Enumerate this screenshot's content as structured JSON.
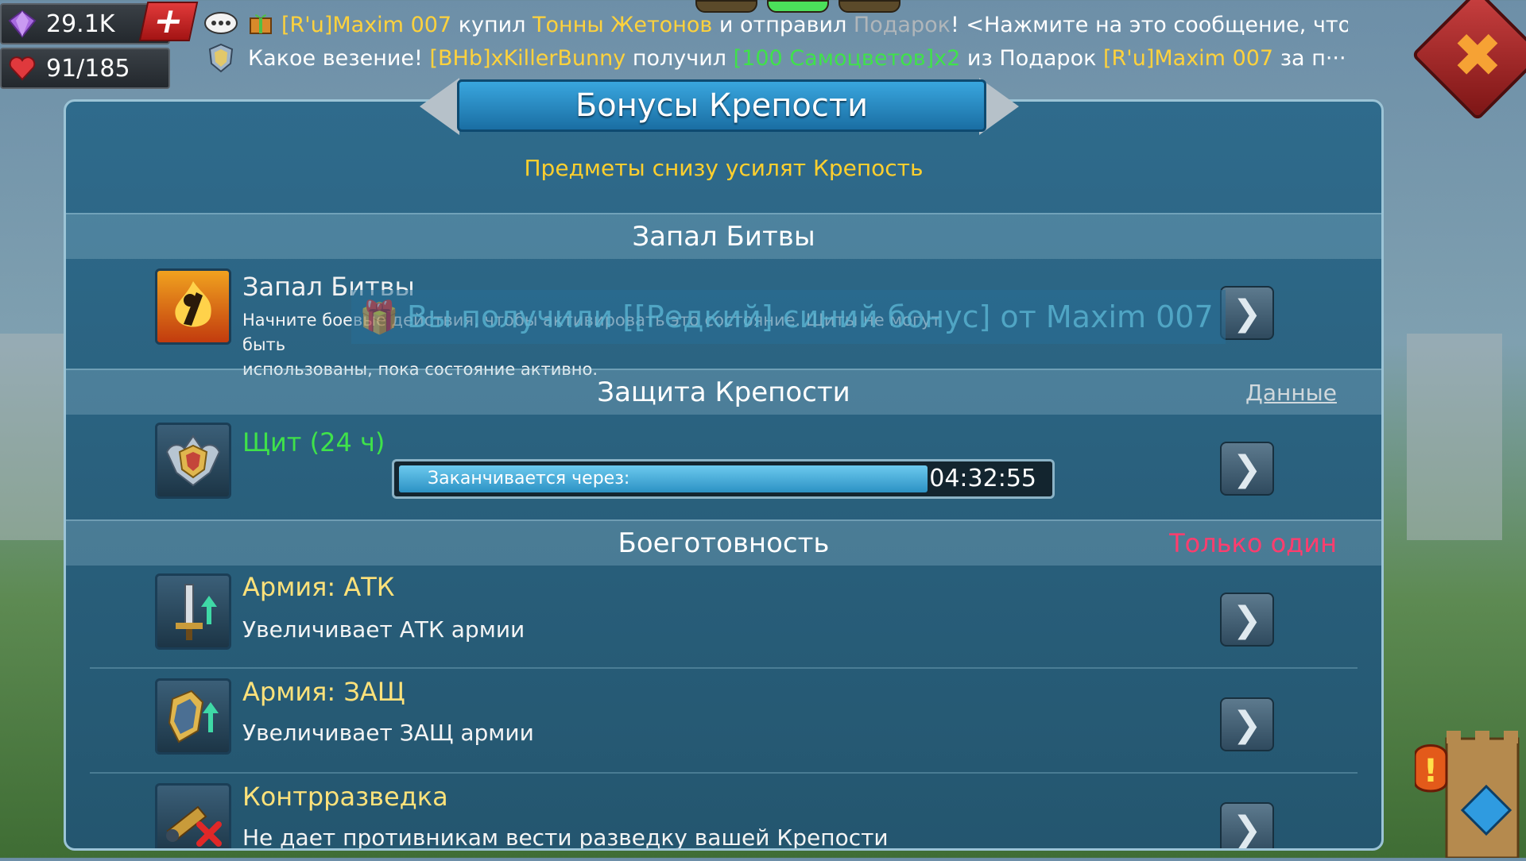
{
  "resources": {
    "gems": "29.1K",
    "stamina": "91/185"
  },
  "chat": {
    "line1": {
      "player": "[R'u]Maxim  007",
      "bought": "купил",
      "item": "Тонны Жетонов",
      "and_sent": "и отправил",
      "gift": "Подарок",
      "tail": "!  <Нажмите на это сообщение, чтобы···"
    },
    "line2": {
      "luck": "Какое везение!",
      "player": "[BHb]xKillerBunny",
      "got": "получил",
      "reward": "[100 Самоцветов]x2",
      "from": "из Подарок",
      "giver": "[R'u]Maxim  007",
      "tail": "за п···"
    }
  },
  "close_glyph": "✖",
  "panel": {
    "title": "Бонусы Крепости",
    "subtitle": "Предметы снизу усилят Крепость"
  },
  "sections": {
    "battle_rage": {
      "header": "Запал Битвы",
      "item_title": "Запал Битвы",
      "item_desc_1": "Начните боевые действия, чтобы активировать это состояние. Щиты не могут быть",
      "item_desc_2": "использованы, пока состояние активно."
    },
    "defense": {
      "header": "Защита Крепости",
      "link": "Данные",
      "item_title": "Щит (24 ч)",
      "timer_label": "Заканчивается через:",
      "timer_value": "04:32:55",
      "timer_fill_percent": 81
    },
    "readiness": {
      "header": "Боеготовность",
      "note": "Только один",
      "items": [
        {
          "title": "Армия: АТК",
          "desc": "Увеличивает АТК армии"
        },
        {
          "title": "Армия: ЗАЩ",
          "desc": "Увеличивает ЗАЩ армии"
        },
        {
          "title": "Контрразведка",
          "desc": "Не дает противникам вести разведку вашей Крепости"
        }
      ]
    }
  },
  "toast": {
    "text": "Вы получили [[Редкий] синий бонус] от Maxim  007"
  },
  "colors": {
    "gold_text": "#ffcf2e",
    "green_text": "#3fe24a",
    "red_note": "#ff3d6e",
    "panel_blue": "#2f6b8c",
    "title_blue": "#1a6ea3"
  }
}
